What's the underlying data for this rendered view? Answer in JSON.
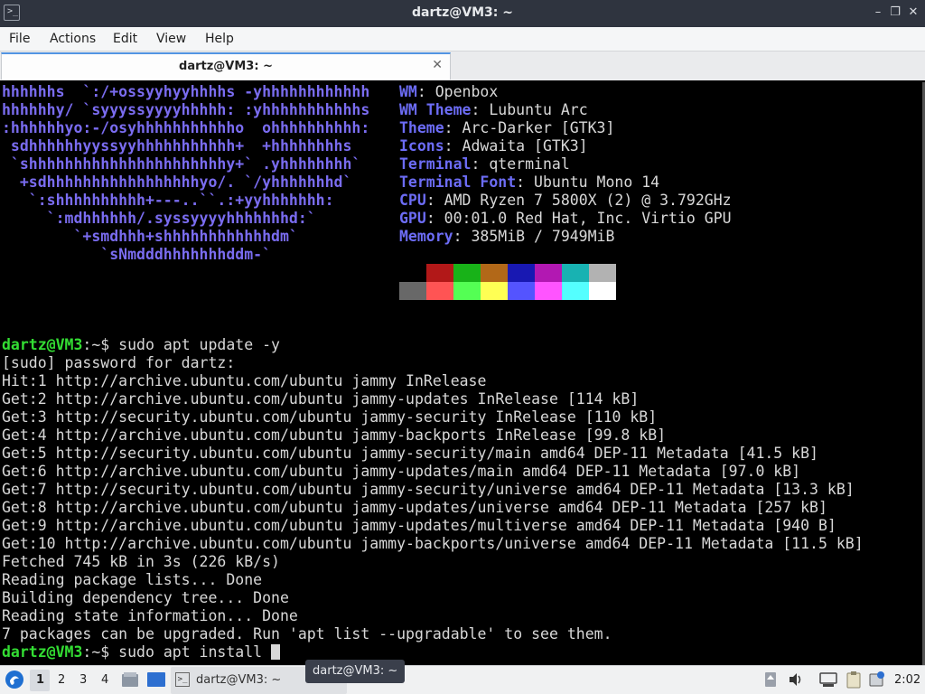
{
  "window": {
    "title": "dartz@VM3: ~"
  },
  "menu": [
    "File",
    "Actions",
    "Edit",
    "View",
    "Help"
  ],
  "tab": {
    "label": "dartz@VM3: ~"
  },
  "logo_lines": [
    "hhhhhhs  `:/+ossyyhyyhhhhs -yhhhhhhhhhhhh",
    "hhhhhhy/ `syyyssyyyyhhhhh: :yhhhhhhhhhhhs",
    ":hhhhhhyo:-/osyhhhhhhhhhhho  ohhhhhhhhhh:",
    " sdhhhhhhyyssyyhhhhhhhhhhh+  +hhhhhhhhs",
    " `shhhhhhhhhhhhhhhhhhhhhhy+` .yhhhhhhhh`",
    "  +sdhhhhhhhhhhhhhhhhhyo/. `/yhhhhhhhd`",
    "   `:shhhhhhhhhh+---..``.:+yyhhhhhhh:",
    "     `:mdhhhhhh/.syssyyyyhhhhhhhd:`",
    "        `+smdhhh+shhhhhhhhhhhhdm`",
    "           `sNmdddhhhhhhhddm-`"
  ],
  "sysinfo": [
    {
      "key": "WM",
      "value": " Openbox"
    },
    {
      "key": "WM Theme",
      "value": " Lubuntu Arc"
    },
    {
      "key": "Theme",
      "value": " Arc-Darker [GTK3]"
    },
    {
      "key": "Icons",
      "value": " Adwaita [GTK3]"
    },
    {
      "key": "Terminal",
      "value": " qterminal"
    },
    {
      "key": "Terminal Font",
      "value": " Ubuntu Mono 14"
    },
    {
      "key": "CPU",
      "value": " AMD Ryzen 7 5800X (2) @ 3.792GHz"
    },
    {
      "key": "GPU",
      "value": " 00:01.0 Red Hat, Inc. Virtio GPU"
    },
    {
      "key": "Memory",
      "value": " 385MiB / 7949MiB"
    }
  ],
  "palette": {
    "row1": [
      "#000000",
      "#b21818",
      "#18b218",
      "#b26818",
      "#1818b2",
      "#b218b2",
      "#18b2b2",
      "#b2b2b2"
    ],
    "row2": [
      "#686868",
      "#ff5454",
      "#54ff54",
      "#ffff54",
      "#5454ff",
      "#ff54ff",
      "#54ffff",
      "#ffffff"
    ]
  },
  "prompt": {
    "user": "dartz@VM3",
    "path": ":~",
    "sym": "$"
  },
  "command1": " sudo apt update -y",
  "output": [
    "[sudo] password for dartz:",
    "Hit:1 http://archive.ubuntu.com/ubuntu jammy InRelease",
    "Get:2 http://archive.ubuntu.com/ubuntu jammy-updates InRelease [114 kB]",
    "Get:3 http://security.ubuntu.com/ubuntu jammy-security InRelease [110 kB]",
    "Get:4 http://archive.ubuntu.com/ubuntu jammy-backports InRelease [99.8 kB]",
    "Get:5 http://security.ubuntu.com/ubuntu jammy-security/main amd64 DEP-11 Metadata [41.5 kB]",
    "Get:6 http://archive.ubuntu.com/ubuntu jammy-updates/main amd64 DEP-11 Metadata [97.0 kB]",
    "Get:7 http://security.ubuntu.com/ubuntu jammy-security/universe amd64 DEP-11 Metadata [13.3 kB]",
    "Get:8 http://archive.ubuntu.com/ubuntu jammy-updates/universe amd64 DEP-11 Metadata [257 kB]",
    "Get:9 http://archive.ubuntu.com/ubuntu jammy-updates/multiverse amd64 DEP-11 Metadata [940 B]",
    "Get:10 http://archive.ubuntu.com/ubuntu jammy-backports/universe amd64 DEP-11 Metadata [11.5 kB]",
    "Fetched 745 kB in 3s (226 kB/s)",
    "Reading package lists... Done",
    "Building dependency tree... Done",
    "Reading state information... Done",
    "7 packages can be upgraded. Run 'apt list --upgradable' to see them."
  ],
  "command2": " sudo apt install ",
  "taskbar": {
    "workspaces": [
      "1",
      "2",
      "3",
      "4"
    ],
    "task_label": "dartz@VM3: ~",
    "tooltip": "dartz@VM3: ~",
    "clock": "2:02"
  },
  "colors": {
    "accent": "#5294e2",
    "prompt_green": "#33dd33",
    "logo_purple": "#7a6cf0"
  }
}
